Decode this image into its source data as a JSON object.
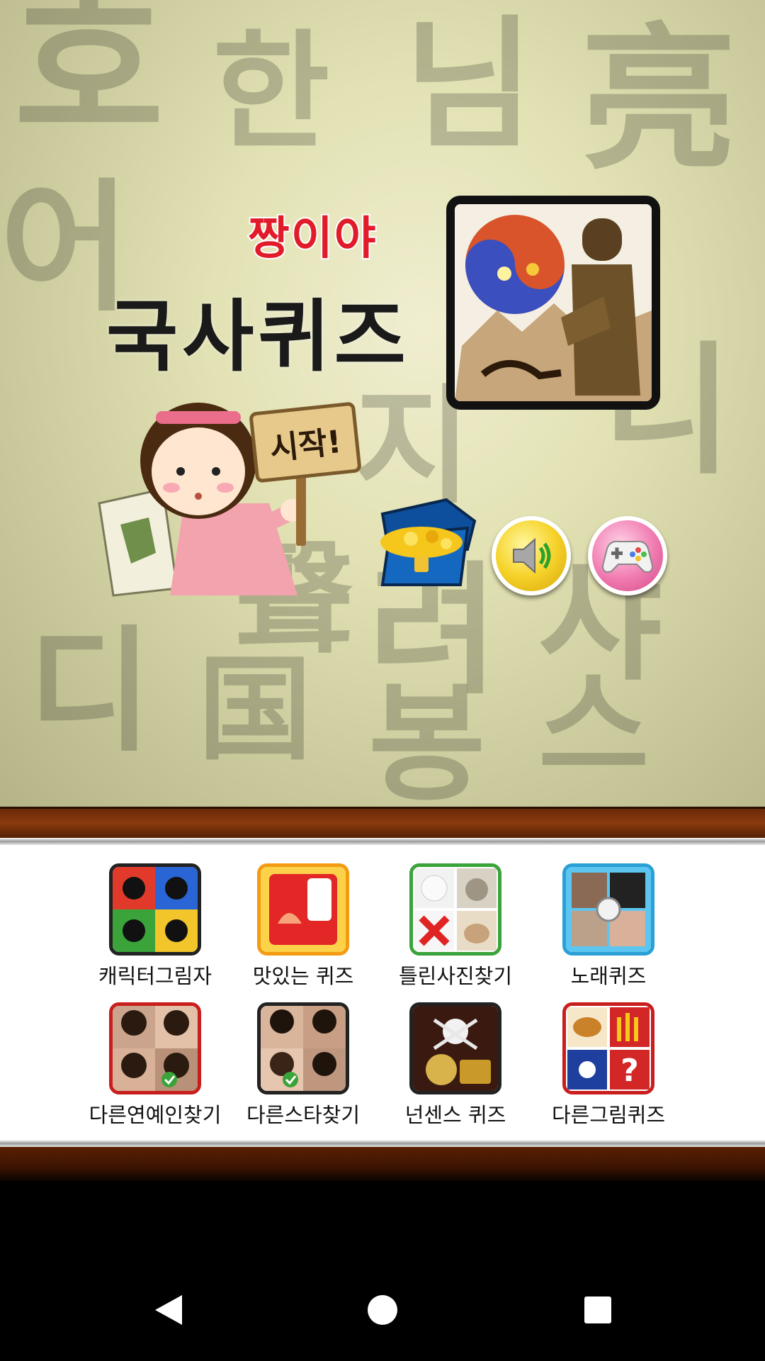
{
  "hero": {
    "subtitle": "짱이야",
    "title": "국사퀴즈",
    "start_label": "시작!"
  },
  "apps": [
    {
      "label": "캐릭터그림자"
    },
    {
      "label": "맛있는 퀴즈"
    },
    {
      "label": "틀린사진찾기"
    },
    {
      "label": "노래퀴즈"
    },
    {
      "label": "다른연예인찾기"
    },
    {
      "label": "다른스타찾기"
    },
    {
      "label": "넌센스 퀴즈"
    },
    {
      "label": "다른그림퀴즈"
    }
  ],
  "colors": {
    "title_accent": "#e11b2a",
    "wood": "#6a2a07",
    "sound_button": "#f6d32a",
    "game_button": "#f07ab0"
  },
  "icons": {
    "sound": "speaker-icon",
    "game": "gamepad-icon",
    "treasure": "treasure-chest-icon",
    "nav_back": "back-triangle-icon",
    "nav_home": "home-circle-icon",
    "nav_recents": "recents-square-icon"
  }
}
